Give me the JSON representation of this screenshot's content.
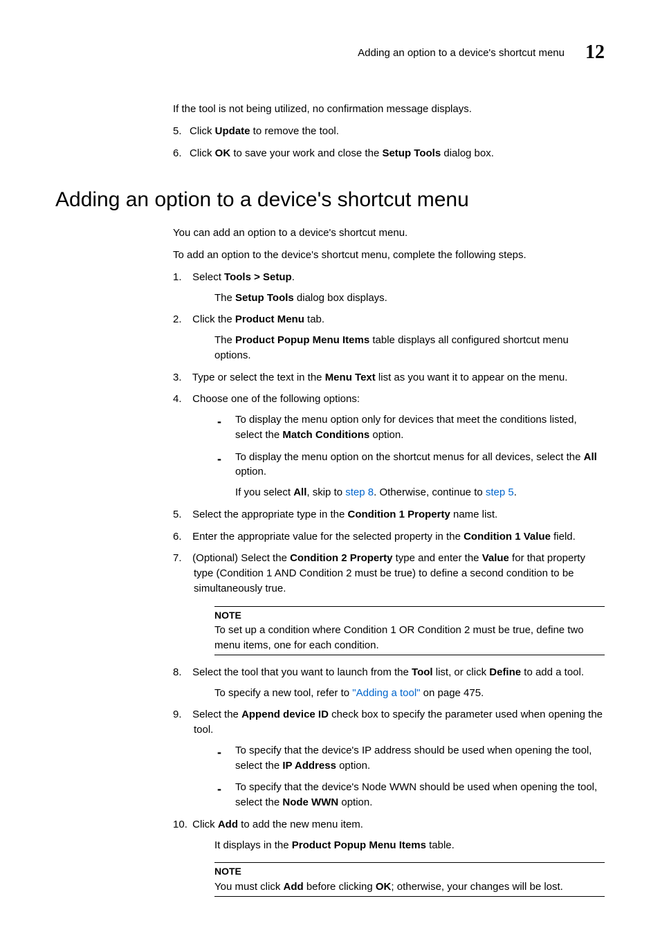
{
  "header": {
    "text": "Adding an option to a device's shortcut menu",
    "number": "12"
  },
  "intro": {
    "line": "If the tool is not being utilized, no confirmation message displays.",
    "step5_a": "Click ",
    "step5_b": "Update",
    "step5_c": " to remove the tool.",
    "step6_a": "Click ",
    "step6_b": "OK",
    "step6_c": " to save your work and close the ",
    "step6_d": "Setup Tools",
    "step6_e": " dialog box."
  },
  "section": {
    "title": "Adding an option to a device's shortcut menu",
    "p1": "You can add an option to a device's shortcut menu.",
    "p2": "To add an option to the device's shortcut menu, complete the following steps."
  },
  "steps": {
    "s1_a": "Select ",
    "s1_b": "Tools > Setup",
    "s1_c": ".",
    "s1_sub_a": "The ",
    "s1_sub_b": "Setup Tools",
    "s1_sub_c": " dialog box displays.",
    "s2_a": "Click the ",
    "s2_b": "Product Menu",
    "s2_c": " tab.",
    "s2_sub_a": "The ",
    "s2_sub_b": "Product Popup Menu Items",
    "s2_sub_c": " table displays all configured shortcut menu options.",
    "s3_a": "Type or select the text in the ",
    "s3_b": "Menu Text",
    "s3_c": " list as you want it to appear on the menu.",
    "s4": "Choose one of the following options:",
    "s4_d1_a": "To display the menu option only for devices that meet the conditions listed, select the ",
    "s4_d1_b": "Match Conditions",
    "s4_d1_c": " option.",
    "s4_d2_a": "To display the menu option on the shortcut menus for all devices, select the ",
    "s4_d2_b": "All",
    "s4_d2_c": " option.",
    "s4_d2_sub_a": "If you select ",
    "s4_d2_sub_b": "All",
    "s4_d2_sub_c": ", skip to ",
    "s4_d2_sub_d": "step 8",
    "s4_d2_sub_e": ". Otherwise, continue to ",
    "s4_d2_sub_f": "step 5",
    "s4_d2_sub_g": ".",
    "s5_a": "Select the appropriate type in the ",
    "s5_b": "Condition 1 Property",
    "s5_c": " name list.",
    "s6_a": "Enter the appropriate value for the selected property in the ",
    "s6_b": "Condition 1 Value",
    "s6_c": " field.",
    "s7_a": "(Optional) Select the ",
    "s7_b": "Condition 2 Property",
    "s7_c": " type and enter the ",
    "s7_d": "Value",
    "s7_e": " for that property type (Condition 1 AND Condition 2 must be true) to define a second condition to be simultaneously true.",
    "note1_label": "NOTE",
    "note1_text": "To set up a condition where Condition 1 OR Condition 2 must be true, define two menu items, one for each condition.",
    "s8_a": "Select the tool that you want to launch from the ",
    "s8_b": "Tool",
    "s8_c": " list, or click ",
    "s8_d": "Define",
    "s8_e": " to add a tool.",
    "s8_sub_a": "To specify a new tool, refer to ",
    "s8_sub_b": "\"Adding a tool\"",
    "s8_sub_c": " on page 475.",
    "s9_a": "Select the ",
    "s9_b": "Append device ID",
    "s9_c": " check box to specify the parameter used when opening the tool.",
    "s9_d1_a": "To specify that the device's IP address should be used when opening the tool, select the ",
    "s9_d1_b": "IP Address",
    "s9_d1_c": " option.",
    "s9_d2_a": "To specify that the device's Node WWN should be used when opening the tool, select the ",
    "s9_d2_b": "Node WWN",
    "s9_d2_c": " option.",
    "s10_a": "Click ",
    "s10_b": "Add",
    "s10_c": " to add the new menu item.",
    "s10_sub_a": "It displays in the ",
    "s10_sub_b": "Product Popup Menu Items",
    "s10_sub_c": " table.",
    "note2_label": "NOTE",
    "note2_text_a": "You must click ",
    "note2_text_b": "Add",
    "note2_text_c": " before clicking ",
    "note2_text_d": "OK",
    "note2_text_e": "; otherwise, your changes will be lost."
  }
}
